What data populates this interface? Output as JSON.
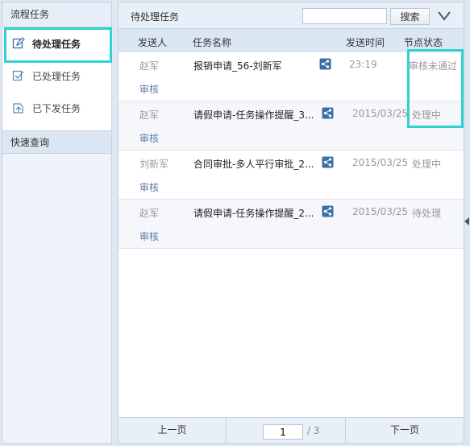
{
  "sidebar": {
    "title": "流程任务",
    "items": [
      {
        "label": "待处理任务",
        "icon": "edit-icon",
        "active": true
      },
      {
        "label": "已处理任务",
        "icon": "done-icon",
        "active": false
      },
      {
        "label": "已下发任务",
        "icon": "sent-icon",
        "active": false
      }
    ],
    "quick_search": "快速查询"
  },
  "panel": {
    "title": "待处理任务",
    "search_placeholder": "",
    "search_button": "搜索",
    "columns": [
      "发送人",
      "任务名称",
      "发送时间",
      "节点状态"
    ],
    "rows": [
      {
        "sender": "赵军",
        "subject": "报销申请_56-刘新军",
        "time": "23:19",
        "status": "审核未通过",
        "action": "审核"
      },
      {
        "sender": "赵军",
        "subject": "请假申请-任务操作提醒_3...",
        "time": "2015/03/25",
        "status": "处理中",
        "action": "审核"
      },
      {
        "sender": "刘新军",
        "subject": "合同审批-多人平行审批_2...",
        "time": "2015/03/25",
        "status": "处理中",
        "action": "审核"
      },
      {
        "sender": "赵军",
        "subject": "请假申请-任务操作提醒_2...",
        "time": "2015/03/25",
        "status": "待处理",
        "action": "审核"
      }
    ],
    "pager": {
      "prev": "上一页",
      "next": "下一页",
      "current": "1",
      "total": "/ 3"
    }
  },
  "colors": {
    "highlight": "#2ed3cf",
    "header_bg": "#dbe6f3",
    "link": "#5b7aa8"
  }
}
